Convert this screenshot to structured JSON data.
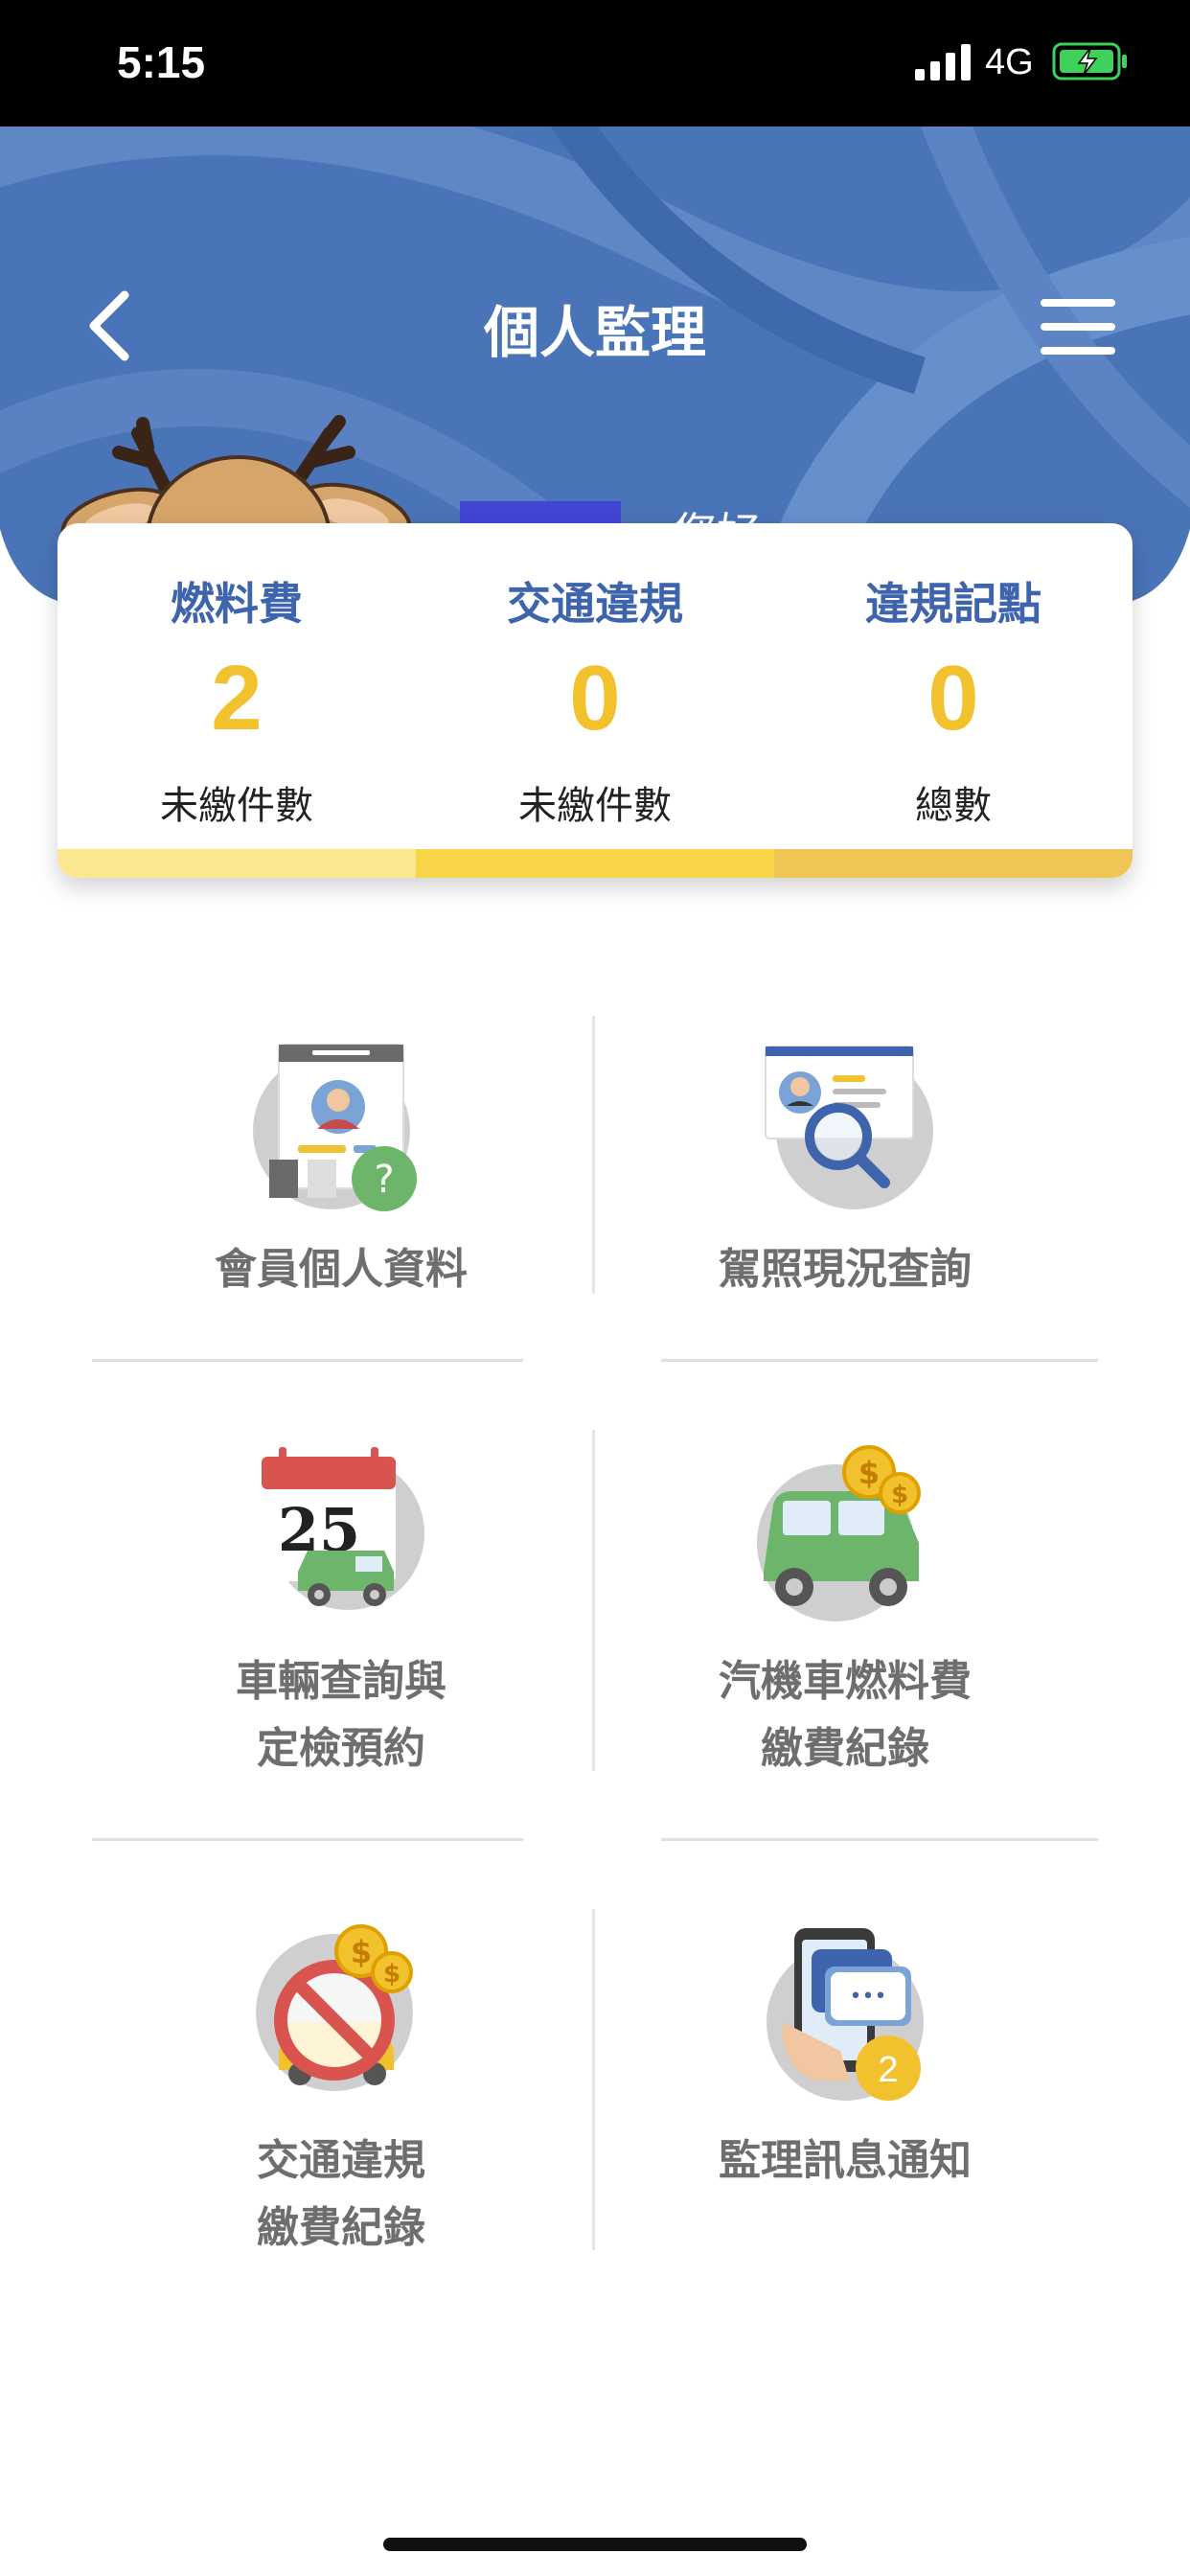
{
  "status_bar": {
    "time": "5:15",
    "network": "4G",
    "signal_icon": "signal-bars-icon",
    "battery_icon": "battery-charging-icon"
  },
  "header": {
    "title": "個人監理",
    "greeting": "，您好",
    "back_icon": "chevron-left-icon",
    "menu_icon": "hamburger-menu-icon",
    "background_color": "#4a74b8"
  },
  "summary": [
    {
      "title": "燃料費",
      "value": "2",
      "label": "未繳件數",
      "bar_color": "#fbe692"
    },
    {
      "title": "交通違規",
      "value": "0",
      "label": "未繳件數",
      "bar_color": "#f7d547"
    },
    {
      "title": "違規記點",
      "value": "0",
      "label": "總數",
      "bar_color": "#efc553"
    }
  ],
  "menu_items": [
    {
      "line1": "會員個人資料",
      "line2": "",
      "icon": "member-profile-icon"
    },
    {
      "line1": "駕照現況查詢",
      "line2": "",
      "icon": "license-search-icon"
    },
    {
      "line1": "車輛查詢與",
      "line2": "定檢預約",
      "icon": "calendar-car-icon"
    },
    {
      "line1": "汽機車燃料費",
      "line2": "繳費紀錄",
      "icon": "car-coins-icon"
    },
    {
      "line1": "交通違規",
      "line2": "繳費紀錄",
      "icon": "no-entry-coins-icon"
    },
    {
      "line1": "監理訊息通知",
      "line2": "",
      "icon": "phone-message-icon"
    }
  ],
  "icon_texts": {
    "calendar_day": "25",
    "notification_count": "2",
    "question_mark": "?",
    "coin_symbol": "$",
    "chat_dots": "•••"
  },
  "colors": {
    "accent_blue": "#3d64ad",
    "value_yellow": "#f2c12e",
    "text_gray": "#6e6e6e"
  }
}
